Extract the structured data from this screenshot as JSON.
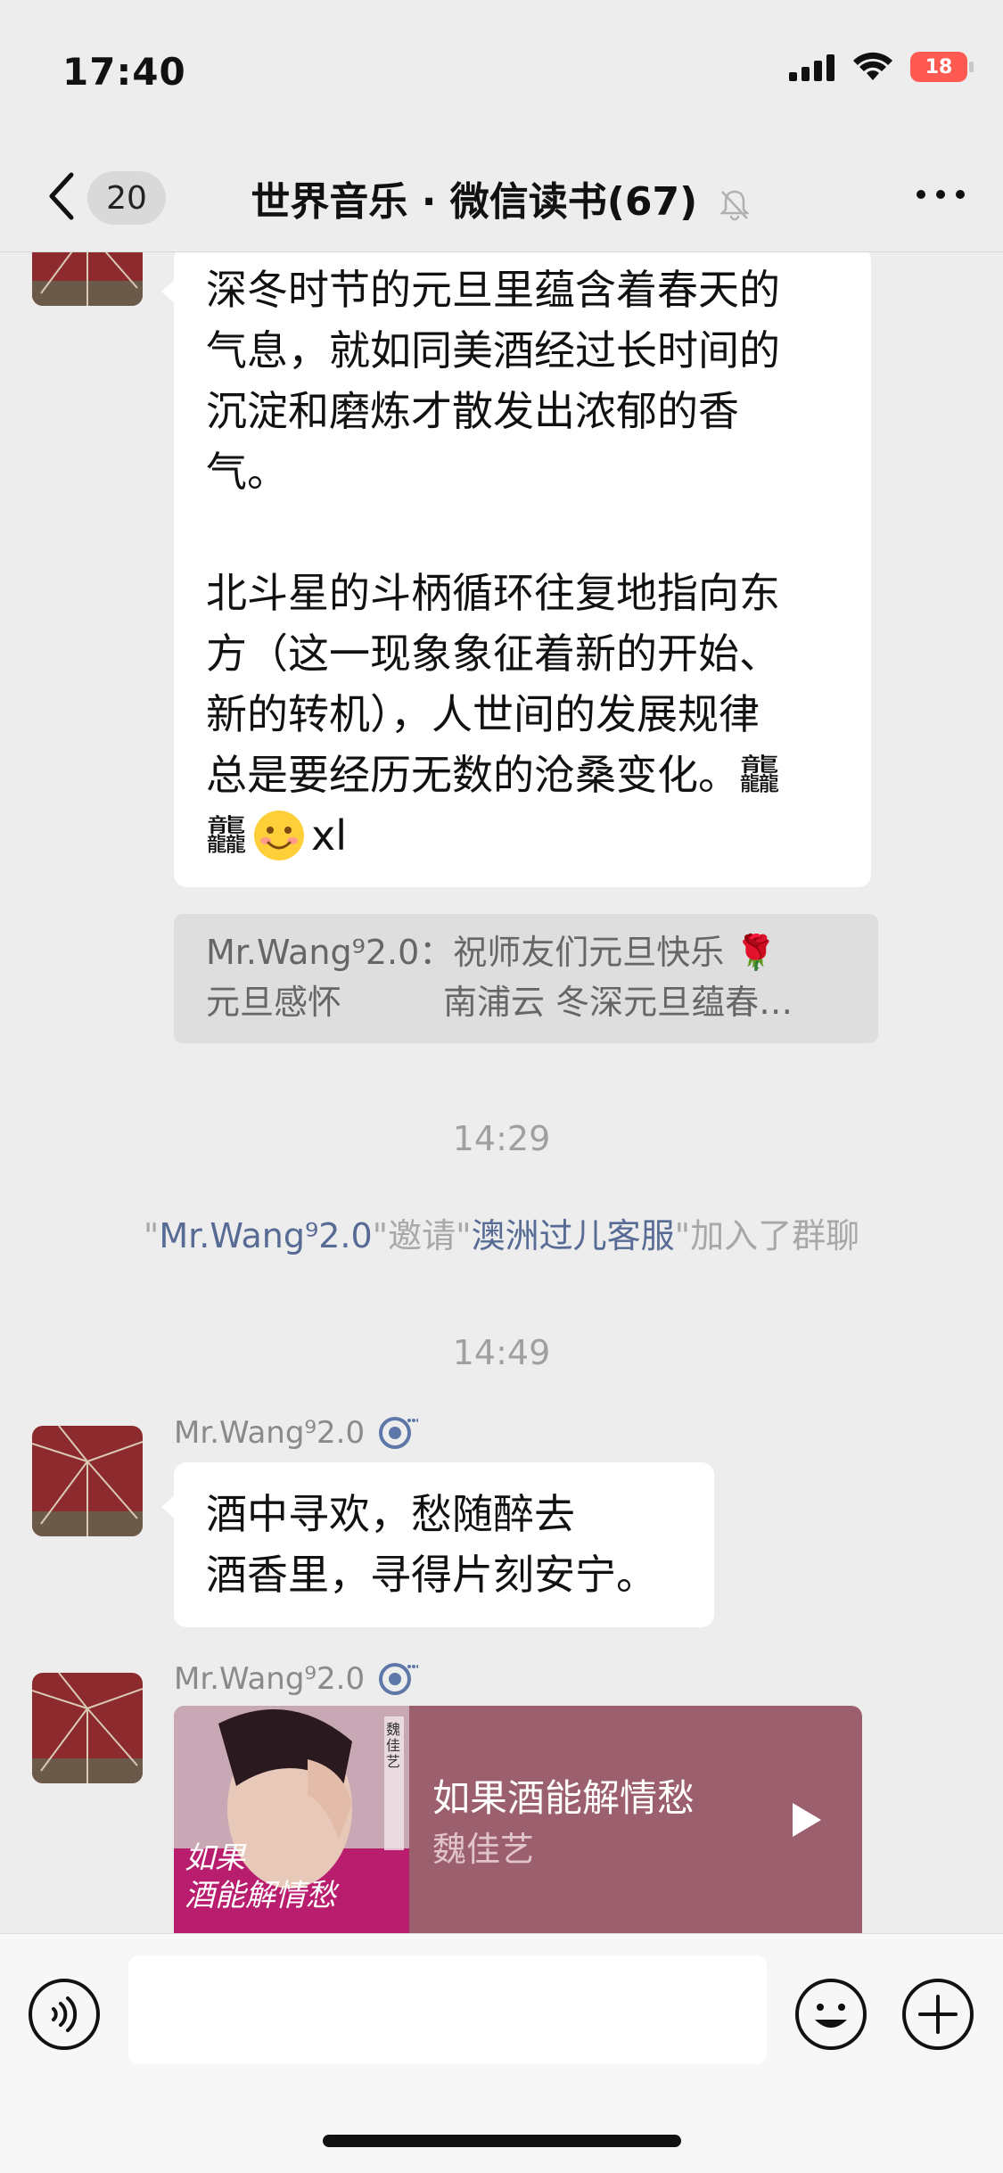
{
  "status_bar": {
    "time": "17:40",
    "battery": "18"
  },
  "nav": {
    "unread_count": "20",
    "title": "世界音乐 · 微信读书(67)"
  },
  "messages": {
    "poem_para1": "深冬时节的元旦里蕴含着春天的\n气息，就如同美酒经过长时间的\n沉淀和磨炼才散发出浓郁的香\n气。",
    "poem_para2_line1": "北斗星的斗柄循环往复地指向东",
    "poem_para2_line2": "方（这一现象象征着新的开始、",
    "poem_para2_line3": "新的转机），人世间的发展规律",
    "poem_para2_line4": "总是要经历无数的沧桑变化。",
    "poem_glyph": "龘",
    "poem_tail_text": "xl",
    "quote_line1": "Mr.Wang⁹2.0：祝师友们元旦快乐 🌹",
    "quote_line2": "元旦感怀　　　南浦云 冬深元旦蕴春…",
    "time1": "14:29",
    "system_prefix": "\"",
    "system_inviter": "Mr.Wang⁹2.0",
    "system_mid": "\"邀请\"",
    "system_invitee": "澳洲过儿客服",
    "system_suffix": "\"加入了群聊",
    "time2": "14:49",
    "sender1": "Mr.Wang⁹2.0",
    "msg2_line1": "酒中寻欢，愁随醉去",
    "msg2_line2": "酒香里，寻得片刻安宁。",
    "sender2": "Mr.Wang⁹2.0",
    "music_title": "如果酒能解情愁",
    "music_artist": "魏佳艺",
    "album_text": "如果\n酒能解情愁",
    "album_side_text": "魏佳艺"
  },
  "colors": {
    "link": "#576b95",
    "music_card": "#9b5f6d",
    "background": "#ededed"
  },
  "icons": [
    "back-chevron-icon",
    "mute-bell-icon",
    "more-dots-icon",
    "voice-icon",
    "emoji-icon",
    "plus-icon",
    "play-icon",
    "ear-speaker-icon"
  ]
}
